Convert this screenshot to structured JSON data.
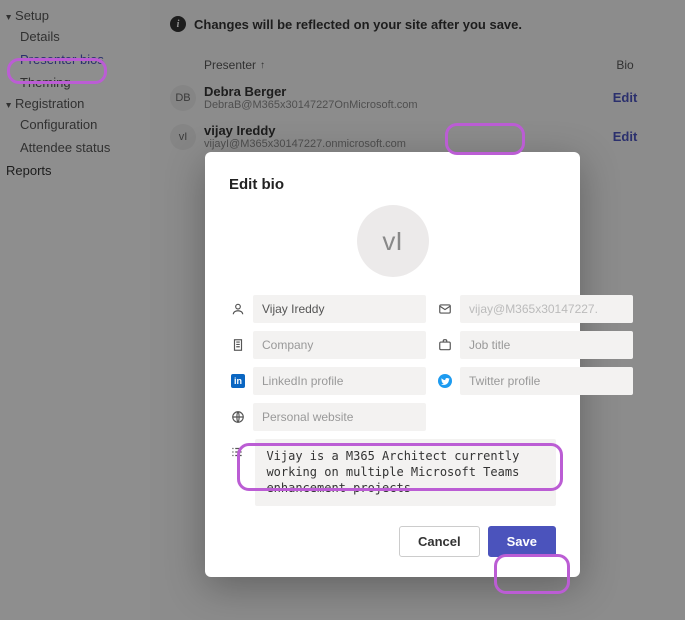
{
  "sidebar": {
    "setup": {
      "label": "Setup",
      "items": [
        "Details",
        "Presenter bios",
        "Theming"
      ]
    },
    "registration": {
      "label": "Registration",
      "items": [
        "Configuration",
        "Attendee status"
      ]
    },
    "reports": {
      "label": "Reports"
    }
  },
  "banner": {
    "text": "Changes will be reflected on your site after you save."
  },
  "table": {
    "col_presenter": "Presenter",
    "col_bio": "Bio",
    "rows": [
      {
        "initials": "DB",
        "name": "Debra Berger",
        "email": "DebraB@M365x30147227OnMicrosoft.com",
        "action": "Edit"
      },
      {
        "initials": "vI",
        "name": "vijay Ireddy",
        "email": "vijayI@M365x30147227.onmicrosoft.com",
        "action": "Edit"
      }
    ]
  },
  "modal": {
    "title": "Edit bio",
    "avatar_initials": "vI",
    "fields": {
      "name_value": "Vijay Ireddy",
      "email_value": "vijay@M365x30147227.",
      "company_placeholder": "Company",
      "jobtitle_placeholder": "Job title",
      "linkedin_placeholder": "LinkedIn profile",
      "twitter_placeholder": "Twitter profile",
      "website_placeholder": "Personal website",
      "bio_value": "Vijay is a M365 Architect currently working on multiple Microsoft Teams enhancement projects"
    },
    "buttons": {
      "cancel": "Cancel",
      "save": "Save"
    }
  }
}
